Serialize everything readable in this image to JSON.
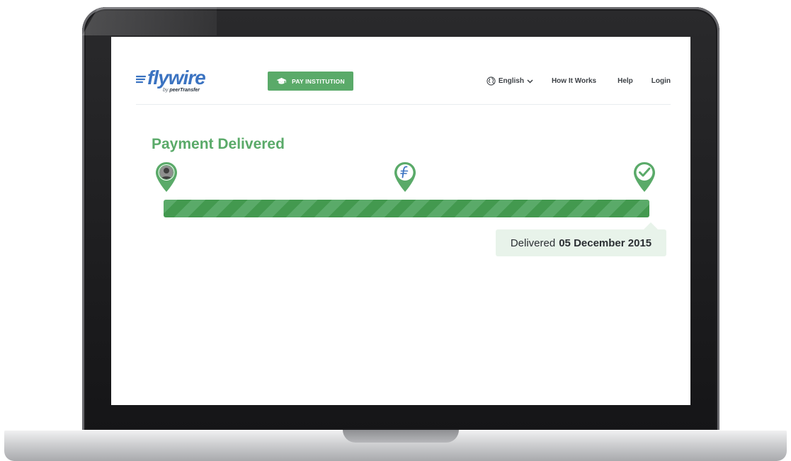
{
  "header": {
    "logo_text": "flywire",
    "logo_by": "by",
    "logo_partner": "peerTransfer",
    "pay_button_label": "PAY INSTITUTION",
    "nav": {
      "language": "English",
      "how_it_works": "How It Works",
      "help": "Help",
      "login": "Login"
    }
  },
  "status": {
    "title": "Payment Delivered",
    "progress": 1.0,
    "steps": [
      {
        "icon": "user-icon"
      },
      {
        "icon": "flywire-icon"
      },
      {
        "icon": "checkmark-icon"
      }
    ],
    "delivered_label": "Delivered",
    "delivered_date": "05 December 2015"
  },
  "colors": {
    "accent_green": "#5aaa69",
    "brand_blue": "#3b73c1",
    "tooltip_bg": "#e8f3ea"
  }
}
